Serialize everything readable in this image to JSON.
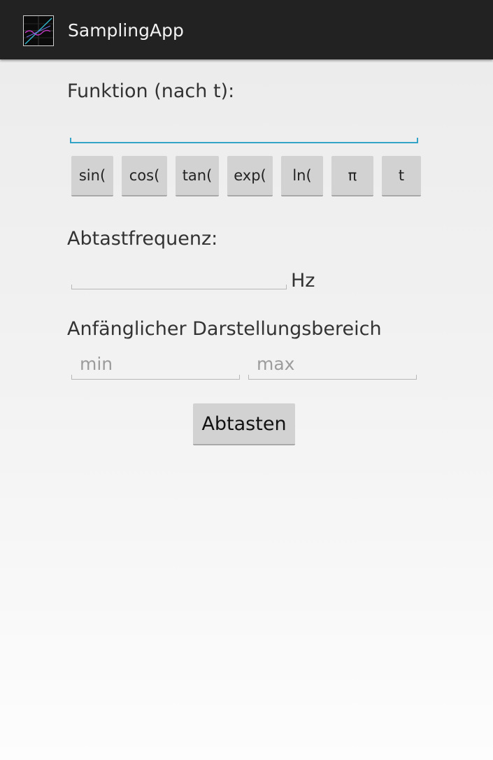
{
  "app": {
    "title": "SamplingApp",
    "icon": "sampling-chart-icon"
  },
  "function_section": {
    "label": "Funktion (nach t):",
    "input_value": ""
  },
  "function_buttons": [
    "sin(",
    "cos(",
    "tan(",
    "exp(",
    "ln(",
    "π",
    "t"
  ],
  "frequency_section": {
    "label": "Abtastfrequenz:",
    "input_value": "",
    "unit": "Hz"
  },
  "range_section": {
    "label": "Anfänglicher Darstellungsbereich",
    "min_placeholder": "min",
    "max_placeholder": "max"
  },
  "sample_button": {
    "label": "Abtasten"
  },
  "colors": {
    "action_bar": "#222222",
    "focus_accent": "#33a3c7",
    "button_bg": "#d2d2d2"
  }
}
